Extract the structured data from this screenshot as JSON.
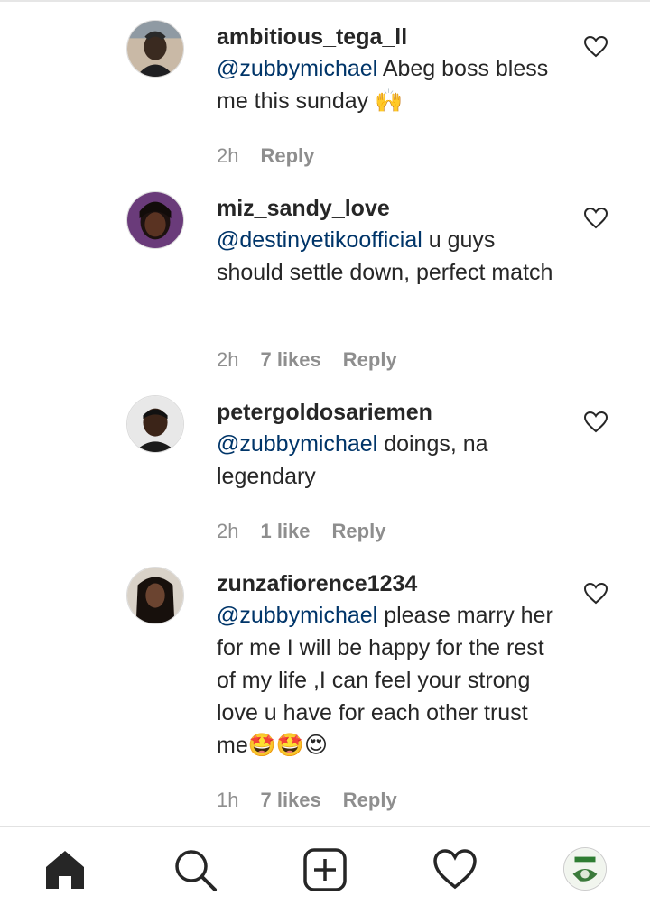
{
  "comments": [
    {
      "username": "ambitious_tega_ll",
      "mention": "@zubbymichael",
      "text": " Abeg boss bless me this sunday 🙌",
      "time": "2h",
      "likes": "",
      "reply": "Reply"
    },
    {
      "username": "miz_sandy_love",
      "mention": "@destinyetikoofficial",
      "text": " u guys should settle down, perfect match",
      "time": "2h",
      "likes": "7 likes",
      "reply": "Reply"
    },
    {
      "username": "petergoldosariemen",
      "mention": "@zubbymichael",
      "text": " doings, na legendary",
      "time": "2h",
      "likes": "1 like",
      "reply": "Reply"
    },
    {
      "username": "zunzafiorence1234",
      "mention": "@zubbymichael",
      "text": " please marry her for me I will be happy for the rest of my life ,I can feel your strong love u have for each other trust me🤩🤩😍",
      "time": "1h",
      "likes": "7 likes",
      "reply": "Reply"
    }
  ],
  "nav": {
    "icons": [
      "home-icon",
      "search-icon",
      "new-post-icon",
      "activity-heart-icon",
      "profile-avatar"
    ]
  },
  "colors": {
    "mention": "#003569",
    "meta": "#8e8e8e",
    "text": "#262626"
  }
}
